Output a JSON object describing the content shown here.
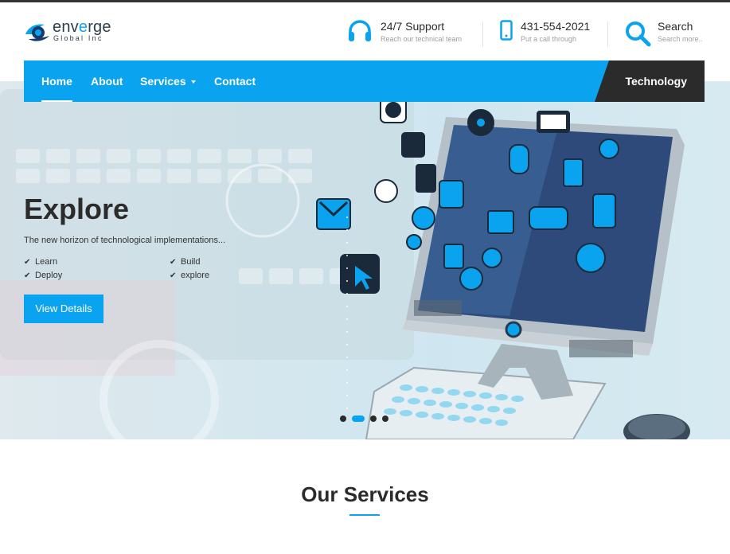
{
  "brand": {
    "name_prefix": "env",
    "name_accent": "e",
    "name_suffix": "rge",
    "subtitle": "Global Inc",
    "accent_color": "#0aa3ef",
    "dark_color": "#2b2b2b"
  },
  "header": {
    "support": {
      "icon": "headset-icon",
      "title": "24/7 Support",
      "subtitle": "Reach our technical team"
    },
    "phone": {
      "icon": "mobile-phone-icon",
      "title": "431-554-2021",
      "subtitle": "Put a call through"
    },
    "search": {
      "icon": "search-icon",
      "title": "Search",
      "subtitle": "Search more.."
    }
  },
  "nav": {
    "items": [
      {
        "label": "Home",
        "active": true
      },
      {
        "label": "About",
        "active": false
      },
      {
        "label": "Services",
        "active": false,
        "has_dropdown": true
      },
      {
        "label": "Contact",
        "active": false
      }
    ],
    "highlight": "Technology"
  },
  "hero": {
    "title": "Explore",
    "subtitle": "The new horizon of technological implementations...",
    "checks": [
      "Learn",
      "Build",
      "Deploy",
      "explore"
    ],
    "button_label": "View Details",
    "slide_count": 4,
    "active_slide": 2
  },
  "services": {
    "title": "Our Services"
  }
}
